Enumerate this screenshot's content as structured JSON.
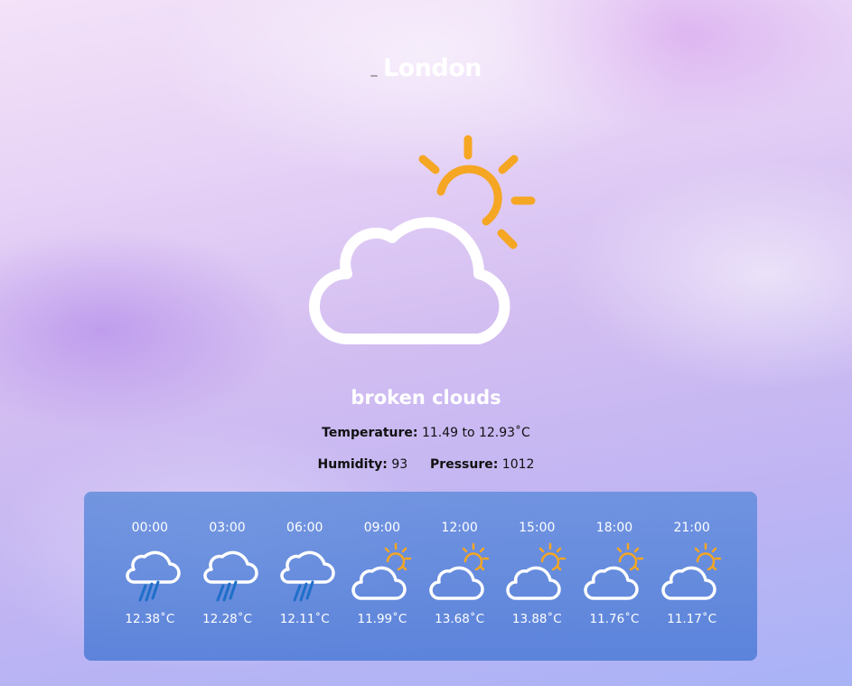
{
  "location": {
    "city": "London"
  },
  "current": {
    "icon": "partly-cloudy-day-icon",
    "description": "broken clouds",
    "temperature_label": "Temperature:",
    "temperature_value": "11.49 to 12.93˚C",
    "humidity_label": "Humidity:",
    "humidity_value": "93",
    "pressure_label": "Pressure:",
    "pressure_value": "1012"
  },
  "forecast": [
    {
      "time": "00:00",
      "icon": "rain-icon",
      "temp": "12.38˚C"
    },
    {
      "time": "03:00",
      "icon": "rain-icon",
      "temp": "12.28˚C"
    },
    {
      "time": "06:00",
      "icon": "rain-icon",
      "temp": "12.11˚C"
    },
    {
      "time": "09:00",
      "icon": "partly-cloudy-icon",
      "temp": "11.99˚C"
    },
    {
      "time": "12:00",
      "icon": "partly-cloudy-icon",
      "temp": "13.68˚C"
    },
    {
      "time": "15:00",
      "icon": "partly-cloudy-icon",
      "temp": "13.88˚C"
    },
    {
      "time": "18:00",
      "icon": "partly-cloudy-icon",
      "temp": "11.76˚C"
    },
    {
      "time": "21:00",
      "icon": "partly-cloudy-icon",
      "temp": "11.17˚C"
    }
  ],
  "colors": {
    "sun": "#F5A623",
    "cloud": "#FFFFFF",
    "rain": "#1E6FC9",
    "panel": "#5F8CDC"
  }
}
